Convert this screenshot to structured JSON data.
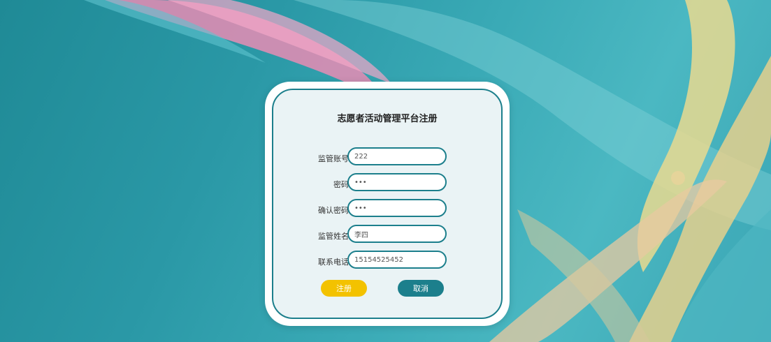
{
  "colors": {
    "accent": "#1c7f8c",
    "register_button": "#f3c200",
    "card_background": "#eaf3f5"
  },
  "form": {
    "title": "志愿者活动管理平台注册",
    "fields": [
      {
        "label": "监管账号",
        "value": "222",
        "type": "text"
      },
      {
        "label": "密码",
        "value": "•••",
        "type": "password"
      },
      {
        "label": "确认密码",
        "value": "•••",
        "type": "password"
      },
      {
        "label": "监管姓名",
        "value": "李四",
        "type": "text"
      },
      {
        "label": "联系电话",
        "value": "15154525452",
        "type": "text"
      }
    ],
    "register_label": "注册",
    "cancel_label": "取消"
  }
}
